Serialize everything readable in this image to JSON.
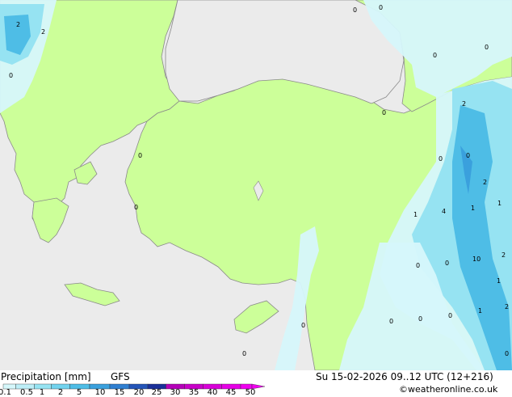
{
  "footer": {
    "title": "Precipitation [mm]",
    "model": "GFS",
    "datetime": "Su 15-02-2026 09..12 UTC (12+216)",
    "credit": "©weatheronline.co.uk"
  },
  "legend": {
    "tick_labels": [
      "0.1",
      "0.5",
      "1",
      "2",
      "5",
      "10",
      "15",
      "20",
      "25",
      "30",
      "35",
      "40",
      "45",
      "50"
    ],
    "colors": [
      "#d6f7fb",
      "#bdeef7",
      "#96e3f2",
      "#72d3ee",
      "#4ebde6",
      "#3aa0dd",
      "#2f7fd1",
      "#2454b8",
      "#1a2f99",
      "#b400b8",
      "#c800c8",
      "#d800d8",
      "#e600e6",
      "#f000f0"
    ]
  },
  "map_labels": [
    "2",
    "2",
    "0",
    "0",
    "0",
    "0",
    "0",
    "0",
    "2",
    "0",
    "0",
    "0",
    "1",
    "4",
    "1",
    "1",
    "0",
    "0",
    "10",
    "2",
    "0",
    "1",
    "0",
    "0",
    "0",
    "1",
    "2",
    "0",
    "0",
    "0",
    "2"
  ],
  "colors": {
    "sea": "#ebebeb",
    "land": "#ccff99",
    "precip_light": "#d6f7fb",
    "precip_medium": "#96e3f2",
    "precip_heavy": "#4ebde6",
    "precip_strong": "#3aa0dd",
    "coast": "#8a8a8a"
  }
}
